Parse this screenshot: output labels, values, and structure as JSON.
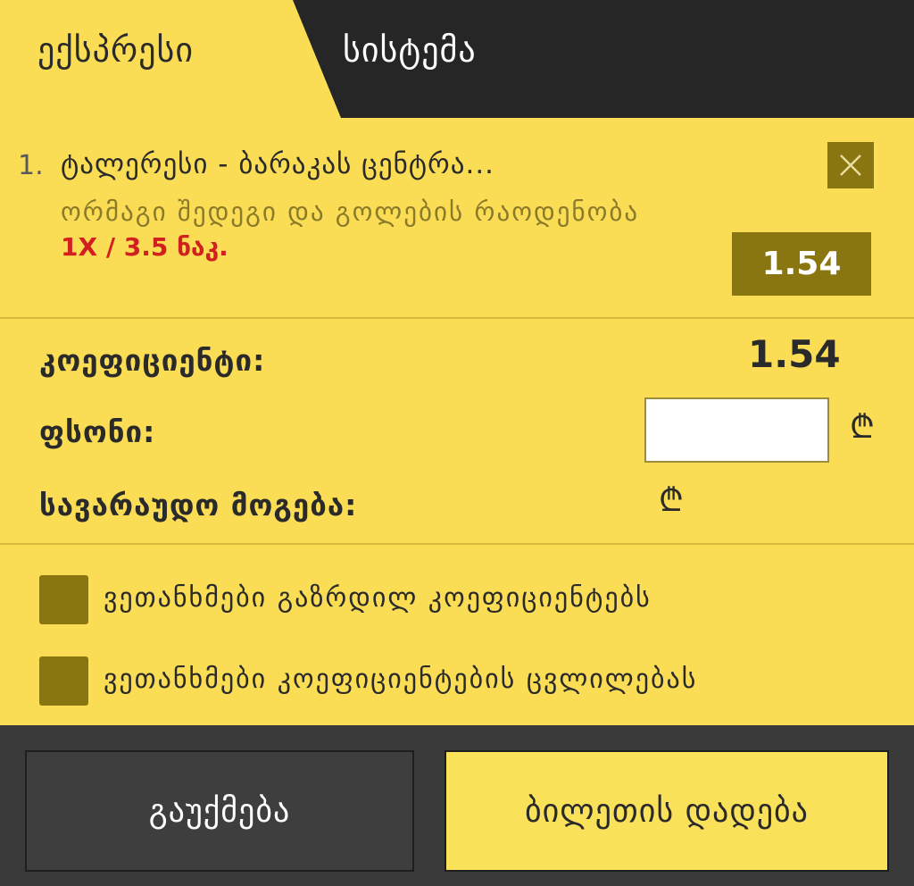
{
  "tabs": {
    "express": "ექსპრესი",
    "system": "სისტემა"
  },
  "bet": {
    "number": "1.",
    "match": "ტალერესი - ბარაკას ცენტრა...",
    "market": "ორმაგი შედეგი და გოლების რაოდენობა",
    "selection": "1X / 3.5 ნაკ.",
    "odds": "1.54",
    "close_icon": "close-icon"
  },
  "summary": {
    "coefficient_label": "კოეფიციენტი:",
    "coefficient_value": "1.54",
    "stake_label": "ფსონი:",
    "stake_value": "",
    "potential_win_label": "სავარაუდო მოგება:",
    "currency_symbol": "₾"
  },
  "options": {
    "accept_increased": "ვეთანხმები გაზრდილ კოეფიციენტებს",
    "accept_changes": "ვეთანხმები კოეფიციენტების ცვლილებას"
  },
  "buttons": {
    "cancel": "გაუქმება",
    "place_bet": "ბილეთის დადება"
  },
  "colors": {
    "accent_yellow": "#fadd54",
    "dark_olive": "#8a7610",
    "tab_dark": "#262626",
    "selection_red": "#d21f1f",
    "footer_dark": "#3a3a3a"
  }
}
